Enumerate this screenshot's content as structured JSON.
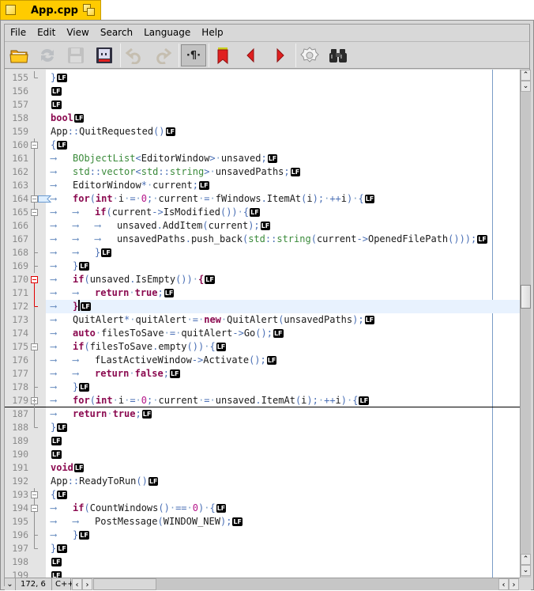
{
  "tab": {
    "title": "App.cpp"
  },
  "menu": [
    "File",
    "Edit",
    "View",
    "Search",
    "Language",
    "Help"
  ],
  "toolbar": {
    "buttons": [
      {
        "name": "open-folder",
        "enabled": true
      },
      {
        "name": "reload",
        "enabled": false
      },
      {
        "name": "save",
        "enabled": false
      },
      {
        "name": "save-as",
        "enabled": true
      },
      {
        "name": "undo",
        "enabled": false
      },
      {
        "name": "redo",
        "enabled": false
      },
      {
        "name": "show-whitespace",
        "enabled": true,
        "pressed": true
      },
      {
        "name": "bookmark",
        "enabled": true
      },
      {
        "name": "previous-bookmark",
        "enabled": true
      },
      {
        "name": "next-bookmark",
        "enabled": true
      },
      {
        "name": "settings",
        "enabled": false
      },
      {
        "name": "find",
        "enabled": true
      }
    ],
    "whitespace_glyph": "·¶·"
  },
  "colors": {
    "tab_yellow": "#ffcb00",
    "keyword": "#8b0a50",
    "type": "#3a8a3a",
    "operator": "#4a6fb5",
    "number": "#b5178a",
    "current_line": "#e8f2fe",
    "fold_highlight": "#e00000",
    "bookmark_red": "#e02020"
  },
  "editor": {
    "current_line": 172,
    "lines": [
      {
        "n": "155",
        "fold": "end",
        "indent": 0,
        "tokens": [
          [
            "op",
            "}"
          ]
        ]
      },
      {
        "n": "156",
        "fold": "none",
        "indent": 0,
        "tokens": []
      },
      {
        "n": "157",
        "fold": "none",
        "indent": 0,
        "tokens": []
      },
      {
        "n": "158",
        "fold": "none",
        "indent": 0,
        "tokens": [
          [
            "kw",
            "bool"
          ]
        ]
      },
      {
        "n": "159",
        "fold": "none",
        "indent": 0,
        "tokens": [
          [
            "",
            "App"
          ],
          [
            "op",
            "::"
          ],
          [
            "",
            "QuitRequested"
          ],
          [
            "op",
            "()"
          ]
        ]
      },
      {
        "n": "160",
        "fold": "open",
        "indent": 0,
        "tokens": [
          [
            "op",
            "{"
          ]
        ]
      },
      {
        "n": "161",
        "fold": "line",
        "indent": 1,
        "tokens": [
          [
            "ty",
            "BObjectList"
          ],
          [
            "op",
            "<"
          ],
          [
            "",
            "EditorWindow"
          ],
          [
            "op",
            ">"
          ],
          [
            "ws",
            "·"
          ],
          [
            "",
            "unsaved"
          ],
          [
            "op",
            ";"
          ]
        ]
      },
      {
        "n": "162",
        "fold": "line",
        "indent": 1,
        "tokens": [
          [
            "ty",
            "std"
          ],
          [
            "op",
            "::"
          ],
          [
            "ty",
            "vector"
          ],
          [
            "op",
            "<"
          ],
          [
            "ty",
            "std"
          ],
          [
            "op",
            "::"
          ],
          [
            "ty",
            "string"
          ],
          [
            "op",
            ">"
          ],
          [
            "ws",
            "·"
          ],
          [
            "",
            "unsavedPaths"
          ],
          [
            "op",
            ";"
          ]
        ]
      },
      {
        "n": "163",
        "fold": "line",
        "indent": 1,
        "tokens": [
          [
            "",
            "EditorWindow"
          ],
          [
            "op",
            "*"
          ],
          [
            "ws",
            "·"
          ],
          [
            "",
            "current"
          ],
          [
            "op",
            ";"
          ]
        ]
      },
      {
        "n": "164",
        "fold": "open-bookmark",
        "indent": 1,
        "tokens": [
          [
            "kw",
            "for"
          ],
          [
            "op",
            "("
          ],
          [
            "kw",
            "int"
          ],
          [
            "ws",
            "·"
          ],
          [
            "",
            "i"
          ],
          [
            "ws",
            "·"
          ],
          [
            "op",
            "="
          ],
          [
            "ws",
            "·"
          ],
          [
            "num",
            "0"
          ],
          [
            "op",
            ";"
          ],
          [
            "ws",
            "·"
          ],
          [
            "",
            "current"
          ],
          [
            "ws",
            "·"
          ],
          [
            "op",
            "="
          ],
          [
            "ws",
            "·"
          ],
          [
            "",
            "fWindows"
          ],
          [
            "op",
            "."
          ],
          [
            "",
            "ItemAt"
          ],
          [
            "op",
            "("
          ],
          [
            "",
            "i"
          ],
          [
            "op",
            ");"
          ],
          [
            "ws",
            "·"
          ],
          [
            "op",
            "++"
          ],
          [
            "",
            "i"
          ],
          [
            "op",
            ")"
          ],
          [
            "ws",
            "·"
          ],
          [
            "op",
            "{"
          ]
        ]
      },
      {
        "n": "165",
        "fold": "open",
        "indent": 2,
        "tokens": [
          [
            "kw",
            "if"
          ],
          [
            "op",
            "("
          ],
          [
            "",
            "current"
          ],
          [
            "op",
            "->"
          ],
          [
            "",
            "IsModified"
          ],
          [
            "op",
            "())"
          ],
          [
            "ws",
            "·"
          ],
          [
            "op",
            "{"
          ]
        ]
      },
      {
        "n": "166",
        "fold": "line",
        "indent": 3,
        "tokens": [
          [
            "",
            "unsaved"
          ],
          [
            "op",
            "."
          ],
          [
            "",
            "AddItem"
          ],
          [
            "op",
            "("
          ],
          [
            "",
            "current"
          ],
          [
            "op",
            ");"
          ]
        ]
      },
      {
        "n": "167",
        "fold": "line",
        "indent": 3,
        "tokens": [
          [
            "",
            "unsavedPaths"
          ],
          [
            "op",
            "."
          ],
          [
            "",
            "push_back"
          ],
          [
            "op",
            "("
          ],
          [
            "ty",
            "std"
          ],
          [
            "op",
            "::"
          ],
          [
            "ty",
            "string"
          ],
          [
            "op",
            "("
          ],
          [
            "",
            "current"
          ],
          [
            "op",
            "->"
          ],
          [
            "",
            "OpenedFilePath"
          ],
          [
            "op",
            "()));"
          ]
        ]
      },
      {
        "n": "168",
        "fold": "mid",
        "indent": 2,
        "tokens": [
          [
            "op",
            "}"
          ]
        ]
      },
      {
        "n": "169",
        "fold": "mid",
        "indent": 1,
        "tokens": [
          [
            "op",
            "}"
          ]
        ]
      },
      {
        "n": "170",
        "fold": "open-active",
        "indent": 1,
        "tokens": [
          [
            "kw",
            "if"
          ],
          [
            "op",
            "("
          ],
          [
            "",
            "unsaved"
          ],
          [
            "op",
            "."
          ],
          [
            "",
            "IsEmpty"
          ],
          [
            "op",
            "())"
          ],
          [
            "ws",
            "·"
          ],
          [
            "kw",
            "{"
          ]
        ]
      },
      {
        "n": "171",
        "fold": "line-active",
        "indent": 2,
        "tokens": [
          [
            "kw",
            "return"
          ],
          [
            "ws",
            "·"
          ],
          [
            "kw",
            "true"
          ],
          [
            "op",
            ";"
          ]
        ]
      },
      {
        "n": "172",
        "fold": "end-active",
        "indent": 1,
        "tokens": [
          [
            "kw",
            "}"
          ]
        ],
        "caret": true
      },
      {
        "n": "173",
        "fold": "line",
        "indent": 1,
        "tokens": [
          [
            "",
            "QuitAlert"
          ],
          [
            "op",
            "*"
          ],
          [
            "ws",
            "·"
          ],
          [
            "",
            "quitAlert"
          ],
          [
            "ws",
            "·"
          ],
          [
            "op",
            "="
          ],
          [
            "ws",
            "·"
          ],
          [
            "kw",
            "new"
          ],
          [
            "ws",
            "·"
          ],
          [
            "",
            "QuitAlert"
          ],
          [
            "op",
            "("
          ],
          [
            "",
            "unsavedPaths"
          ],
          [
            "op",
            ");"
          ]
        ]
      },
      {
        "n": "174",
        "fold": "line",
        "indent": 1,
        "tokens": [
          [
            "kw",
            "auto"
          ],
          [
            "ws",
            "·"
          ],
          [
            "",
            "filesToSave"
          ],
          [
            "ws",
            "·"
          ],
          [
            "op",
            "="
          ],
          [
            "ws",
            "·"
          ],
          [
            "",
            "quitAlert"
          ],
          [
            "op",
            "->"
          ],
          [
            "",
            "Go"
          ],
          [
            "op",
            "();"
          ]
        ]
      },
      {
        "n": "175",
        "fold": "open",
        "indent": 1,
        "tokens": [
          [
            "kw",
            "if"
          ],
          [
            "op",
            "("
          ],
          [
            "",
            "filesToSave"
          ],
          [
            "op",
            "."
          ],
          [
            "",
            "empty"
          ],
          [
            "op",
            "())"
          ],
          [
            "ws",
            "·"
          ],
          [
            "op",
            "{"
          ]
        ]
      },
      {
        "n": "176",
        "fold": "line",
        "indent": 2,
        "tokens": [
          [
            "",
            "fLastActiveWindow"
          ],
          [
            "op",
            "->"
          ],
          [
            "",
            "Activate"
          ],
          [
            "op",
            "();"
          ]
        ]
      },
      {
        "n": "177",
        "fold": "line",
        "indent": 2,
        "tokens": [
          [
            "kw",
            "return"
          ],
          [
            "ws",
            "·"
          ],
          [
            "kw",
            "false"
          ],
          [
            "op",
            ";"
          ]
        ]
      },
      {
        "n": "178",
        "fold": "mid",
        "indent": 1,
        "tokens": [
          [
            "op",
            "}"
          ]
        ]
      },
      {
        "n": "179",
        "fold": "closed",
        "indent": 1,
        "folded": true,
        "tokens": [
          [
            "kw",
            "for"
          ],
          [
            "op",
            "("
          ],
          [
            "kw",
            "int"
          ],
          [
            "ws",
            "·"
          ],
          [
            "",
            "i"
          ],
          [
            "ws",
            "·"
          ],
          [
            "op",
            "="
          ],
          [
            "ws",
            "·"
          ],
          [
            "num",
            "0"
          ],
          [
            "op",
            ";"
          ],
          [
            "ws",
            "·"
          ],
          [
            "",
            "current"
          ],
          [
            "ws",
            "·"
          ],
          [
            "op",
            "="
          ],
          [
            "ws",
            "·"
          ],
          [
            "",
            "unsaved"
          ],
          [
            "op",
            "."
          ],
          [
            "",
            "ItemAt"
          ],
          [
            "op",
            "("
          ],
          [
            "",
            "i"
          ],
          [
            "op",
            ");"
          ],
          [
            "ws",
            "·"
          ],
          [
            "op",
            "++"
          ],
          [
            "",
            "i"
          ],
          [
            "op",
            ")"
          ],
          [
            "ws",
            "·"
          ],
          [
            "op",
            "{"
          ]
        ]
      },
      {
        "n": "187",
        "fold": "line",
        "indent": 1,
        "tokens": [
          [
            "kw",
            "return"
          ],
          [
            "ws",
            "·"
          ],
          [
            "kw",
            "true"
          ],
          [
            "op",
            ";"
          ]
        ]
      },
      {
        "n": "188",
        "fold": "end",
        "indent": 0,
        "tokens": [
          [
            "op",
            "}"
          ]
        ]
      },
      {
        "n": "189",
        "fold": "none",
        "indent": 0,
        "tokens": []
      },
      {
        "n": "190",
        "fold": "none",
        "indent": 0,
        "tokens": []
      },
      {
        "n": "191",
        "fold": "none",
        "indent": 0,
        "tokens": [
          [
            "kw",
            "void"
          ]
        ]
      },
      {
        "n": "192",
        "fold": "none",
        "indent": 0,
        "tokens": [
          [
            "",
            "App"
          ],
          [
            "op",
            "::"
          ],
          [
            "",
            "ReadyToRun"
          ],
          [
            "op",
            "()"
          ]
        ]
      },
      {
        "n": "193",
        "fold": "open",
        "indent": 0,
        "tokens": [
          [
            "op",
            "{"
          ]
        ]
      },
      {
        "n": "194",
        "fold": "open",
        "indent": 1,
        "tokens": [
          [
            "kw",
            "if"
          ],
          [
            "op",
            "("
          ],
          [
            "",
            "CountWindows"
          ],
          [
            "op",
            "()"
          ],
          [
            "ws",
            "·"
          ],
          [
            "op",
            "=="
          ],
          [
            "ws",
            "·"
          ],
          [
            "num",
            "0"
          ],
          [
            "op",
            ")"
          ],
          [
            "ws",
            "·"
          ],
          [
            "op",
            "{"
          ]
        ]
      },
      {
        "n": "195",
        "fold": "line",
        "indent": 2,
        "tokens": [
          [
            "",
            "PostMessage"
          ],
          [
            "op",
            "("
          ],
          [
            "",
            "WINDOW_NEW"
          ],
          [
            "op",
            ");"
          ]
        ]
      },
      {
        "n": "196",
        "fold": "mid",
        "indent": 1,
        "tokens": [
          [
            "op",
            "}"
          ]
        ]
      },
      {
        "n": "197",
        "fold": "end",
        "indent": 0,
        "tokens": [
          [
            "op",
            "}"
          ]
        ]
      },
      {
        "n": "198",
        "fold": "none",
        "indent": 0,
        "tokens": []
      },
      {
        "n": "199",
        "fold": "none",
        "indent": 0,
        "tokens": []
      }
    ],
    "eol_marker": "LF",
    "tab_marker": "⟶"
  },
  "status": {
    "position": "172, 6",
    "language": "C++"
  },
  "scrollbar": {
    "vertical_position": 0.44
  }
}
